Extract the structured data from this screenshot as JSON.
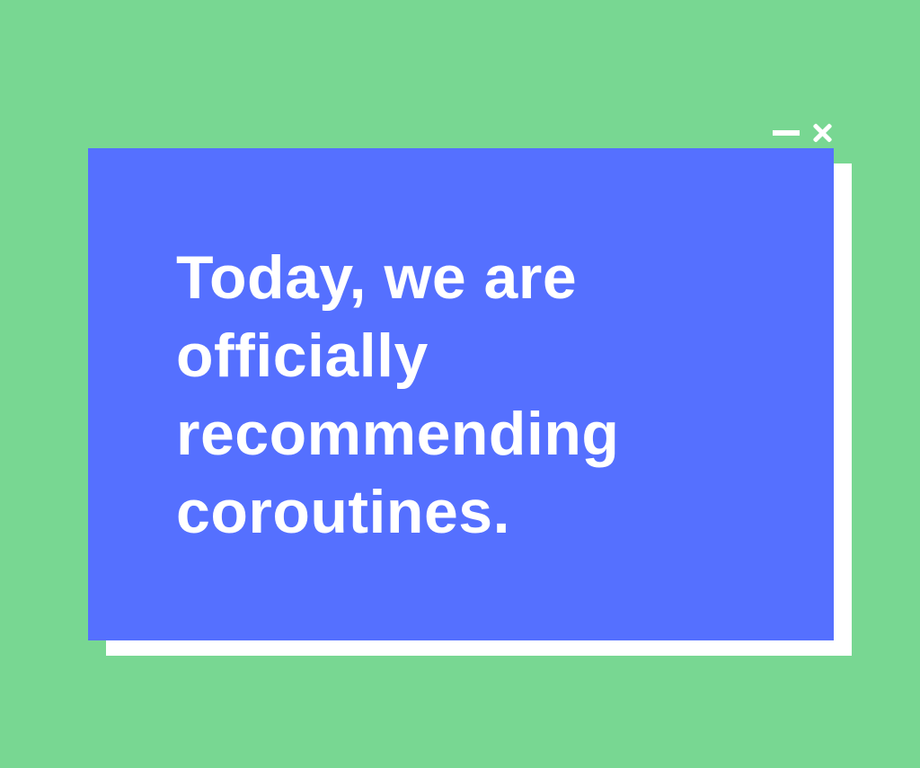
{
  "colors": {
    "background": "#78D792",
    "window": "#5570FF",
    "shadow": "#FFFFFF",
    "text": "#FFFFFF",
    "controls": "#FFFFFF"
  },
  "window": {
    "controls": [
      "minimize-icon",
      "close-icon"
    ],
    "message_lines": [
      "Today, we are",
      "officially",
      "recommending",
      "coroutines."
    ]
  }
}
